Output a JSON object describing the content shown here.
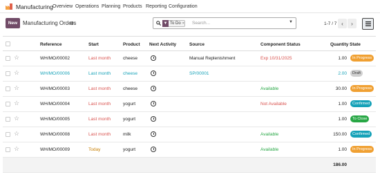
{
  "app": {
    "name": "Manufacturing"
  },
  "menu": [
    "Overview",
    "Operations",
    "Planning",
    "Products",
    "Reporting",
    "Configuration"
  ],
  "control": {
    "new_label": "New",
    "title": "Manufacturing Orders",
    "facet_label": "To Do",
    "search_placeholder": "Search...",
    "pager": "1-7 / 7"
  },
  "columns": {
    "reference": "Reference",
    "start": "Start",
    "product": "Product",
    "next_activity": "Next Activity",
    "source": "Source",
    "component_status": "Component Status",
    "quantity": "Quantity",
    "state": "State"
  },
  "rows": [
    {
      "reference": "WH/MO/00002",
      "start": "Last month",
      "product": "cheese",
      "source": "Manual Replenishment",
      "component_status": "Exp 10/31/2025",
      "quantity": "1.00",
      "state": "In Progress"
    },
    {
      "reference": "WH/MO/00006",
      "start": "Last month",
      "product": "cheese",
      "source": "SP/00001",
      "component_status": "",
      "quantity": "2.00",
      "state": "Draft"
    },
    {
      "reference": "WH/MO/00003",
      "start": "Last month",
      "product": "cheese",
      "source": "",
      "component_status": "Available",
      "quantity": "30.00",
      "state": "In Progress"
    },
    {
      "reference": "WH/MO/00004",
      "start": "Last month",
      "product": "yogurt",
      "source": "",
      "component_status": "Not Available",
      "quantity": "1.00",
      "state": "Confirmed"
    },
    {
      "reference": "WH/MO/00005",
      "start": "Last month",
      "product": "yogurt",
      "source": "",
      "component_status": "",
      "quantity": "1.00",
      "state": "To Close"
    },
    {
      "reference": "WH/MO/00008",
      "start": "Last month",
      "product": "milk",
      "source": "",
      "component_status": "Available",
      "quantity": "150.00",
      "state": "Confirmed"
    },
    {
      "reference": "WH/MO/00009",
      "start": "Today",
      "product": "yogurt",
      "source": "",
      "component_status": "Available",
      "quantity": "1.00",
      "state": "In Progress"
    }
  ],
  "total_quantity": "186.00",
  "colors": {
    "brand": "#714b67",
    "in_progress": "#f0a032",
    "draft": "#d0d0d0",
    "confirmed": "#17a2b8",
    "to_close": "#28a745"
  }
}
